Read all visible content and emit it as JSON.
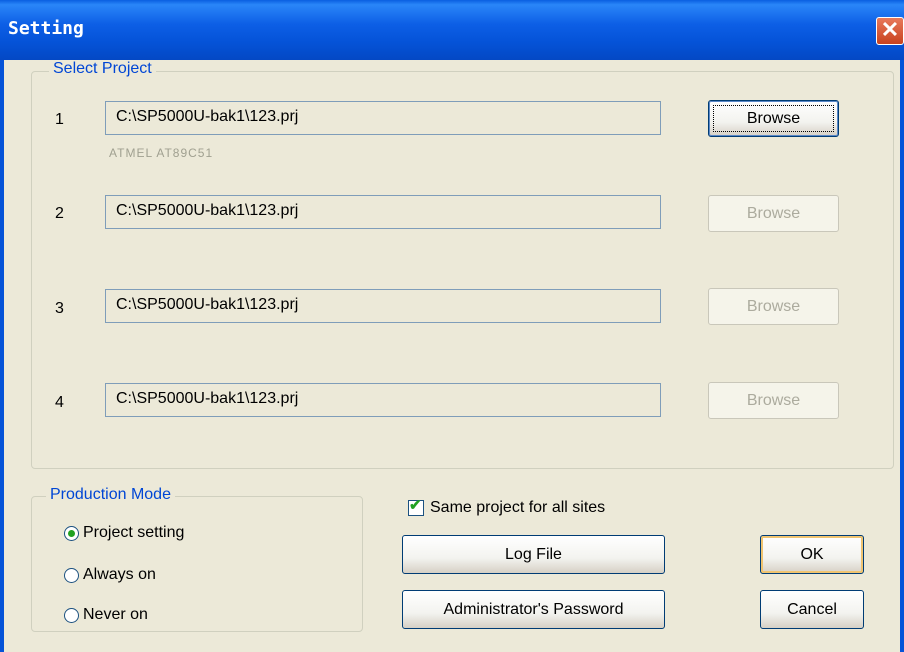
{
  "window": {
    "title": "Setting",
    "close_symbol": "✕"
  },
  "select_project": {
    "legend": "Select Project",
    "rows": [
      {
        "number": "1",
        "path": "C:\\SP5000U-bak1\\123.prj",
        "chip": "ATMEL AT89C51",
        "browse_label": "Browse",
        "enabled": true
      },
      {
        "number": "2",
        "path": "C:\\SP5000U-bak1\\123.prj",
        "browse_label": "Browse",
        "enabled": false
      },
      {
        "number": "3",
        "path": "C:\\SP5000U-bak1\\123.prj",
        "browse_label": "Browse",
        "enabled": false
      },
      {
        "number": "4",
        "path": "C:\\SP5000U-bak1\\123.prj",
        "browse_label": "Browse",
        "enabled": false
      }
    ]
  },
  "production_mode": {
    "legend": "Production Mode",
    "options": [
      {
        "label": "Project setting",
        "selected": true
      },
      {
        "label": "Always on",
        "selected": false
      },
      {
        "label": "Never on",
        "selected": false
      }
    ]
  },
  "same_project": {
    "label": "Same project for all sites",
    "checked": true
  },
  "buttons": {
    "log_file": "Log File",
    "admin_password": "Administrator's Password",
    "ok": "OK",
    "cancel": "Cancel"
  }
}
